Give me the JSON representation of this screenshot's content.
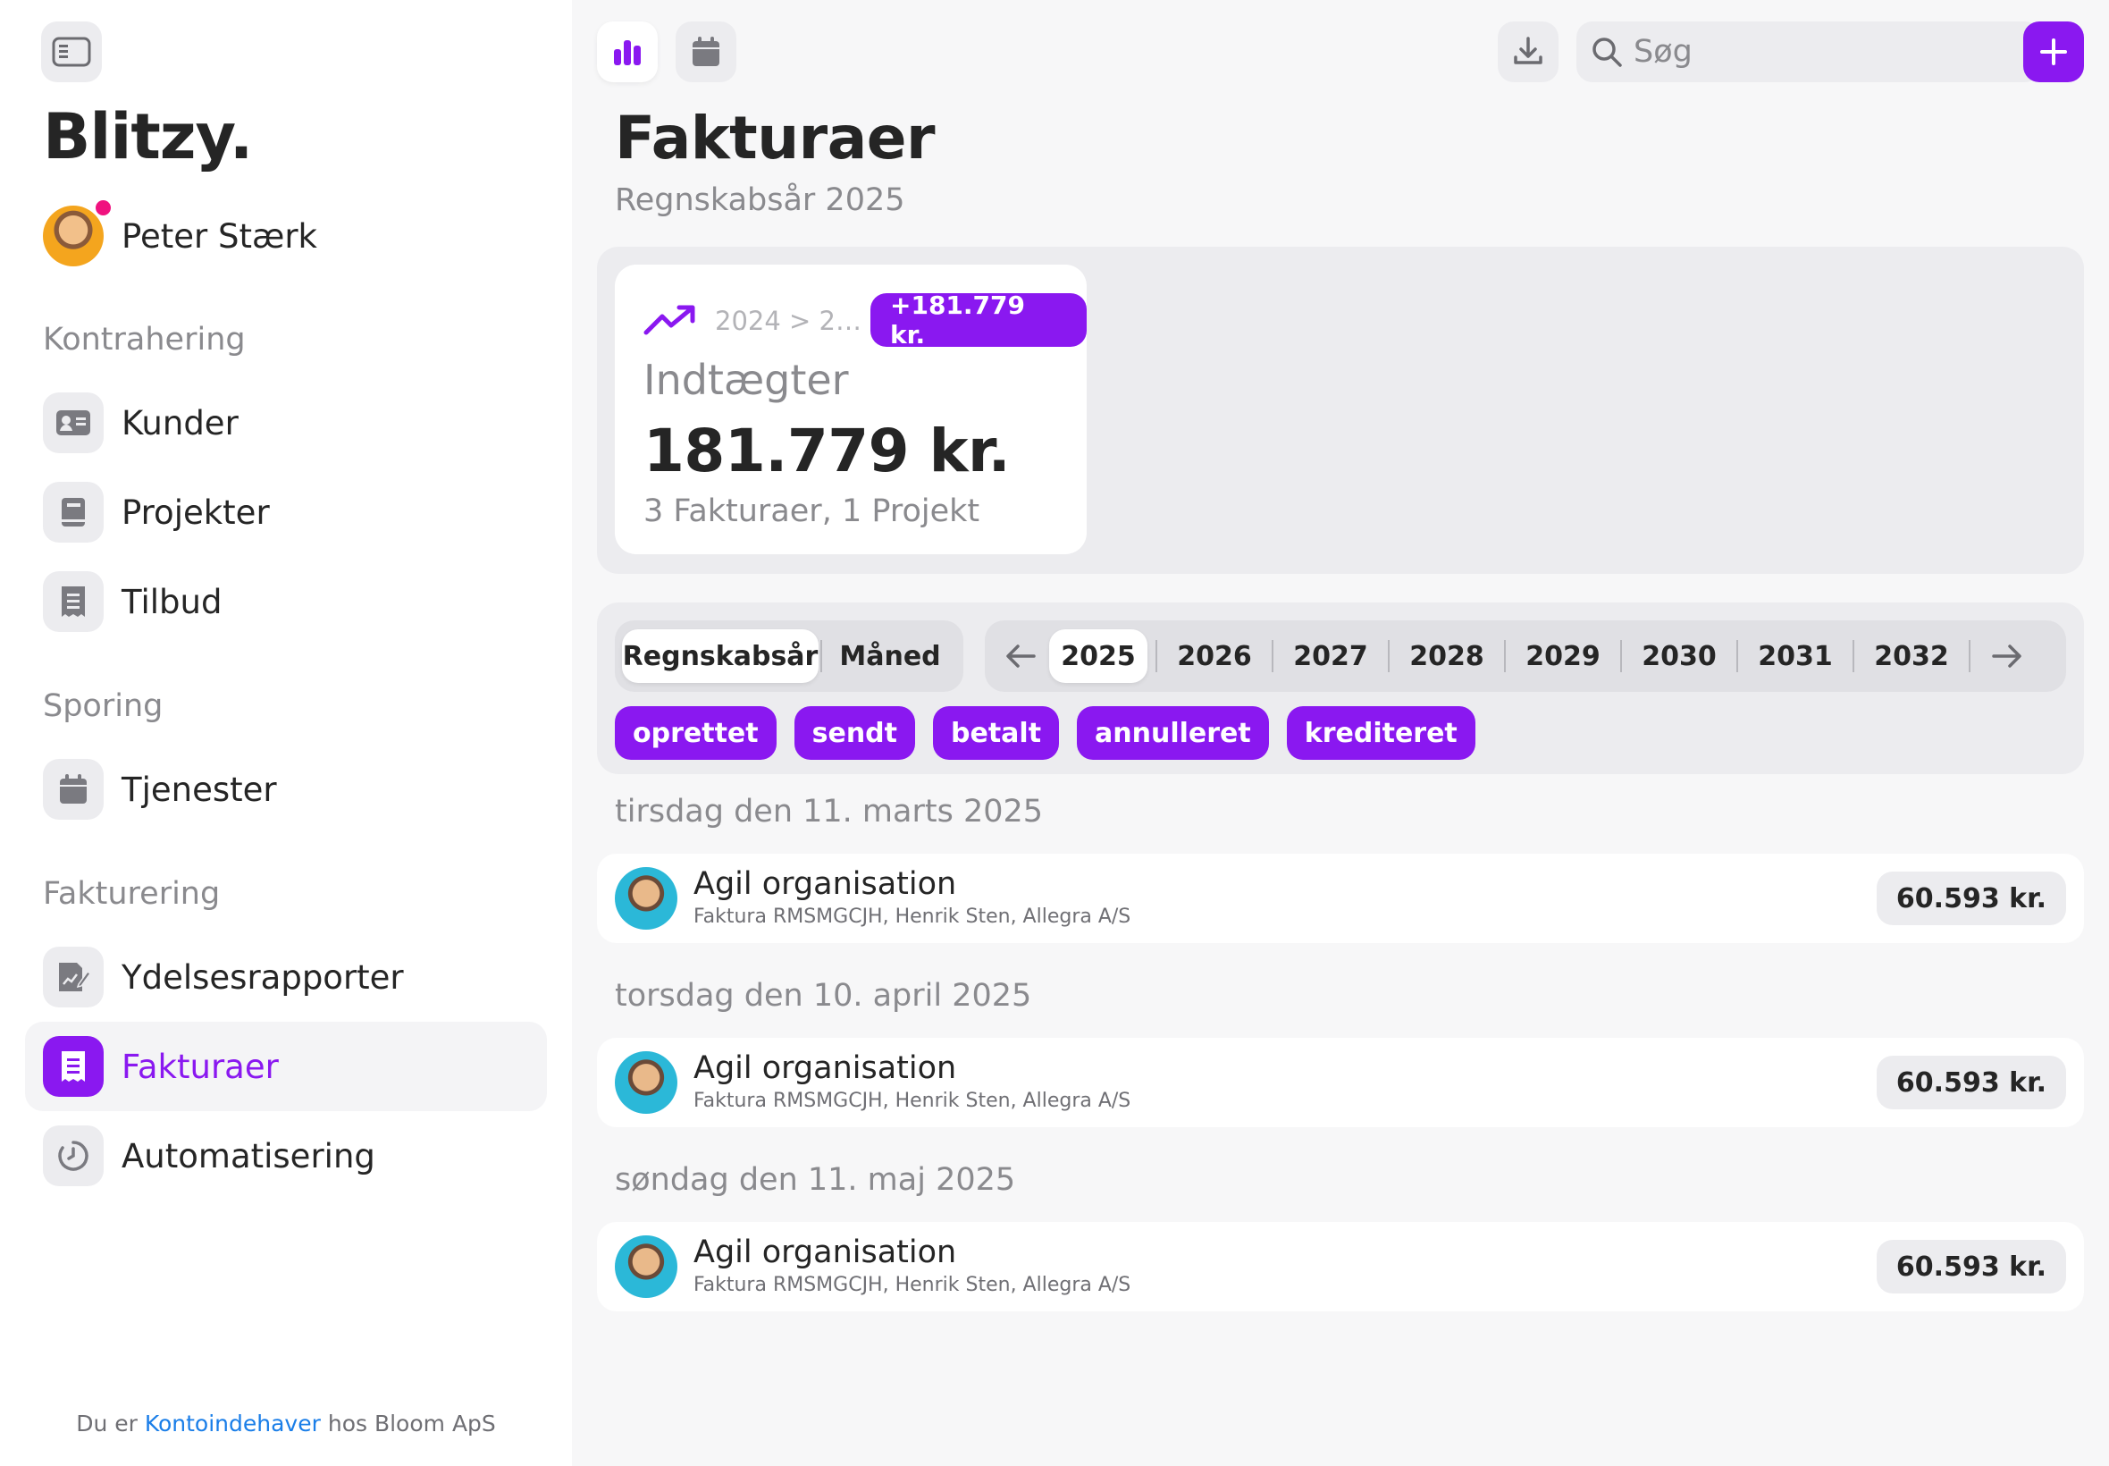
{
  "app": {
    "brand": "Blitzy."
  },
  "user": {
    "name": "Peter Stærk"
  },
  "sidebar": {
    "sections": [
      {
        "label": "Kontrahering"
      },
      {
        "label": "Sporing"
      },
      {
        "label": "Fakturering"
      }
    ],
    "items": [
      {
        "label": "Kunder",
        "icon": "contact-card-icon"
      },
      {
        "label": "Projekter",
        "icon": "book-icon"
      },
      {
        "label": "Tilbud",
        "icon": "receipt-icon"
      },
      {
        "label": "Tjenester",
        "icon": "calendar-icon"
      },
      {
        "label": "Ydelsesrapporter",
        "icon": "report-edit-icon"
      },
      {
        "label": "Fakturaer",
        "icon": "invoice-icon",
        "active": true
      },
      {
        "label": "Automatisering",
        "icon": "cycle-icon"
      }
    ],
    "footer": {
      "prefix": "Du er",
      "role": "Kontoindehaver",
      "suffix": "hos Bloom ApS"
    }
  },
  "toolbar": {
    "search_placeholder": "Søg"
  },
  "page": {
    "title": "Fakturaer",
    "subtitle": "Regnskabsår 2025"
  },
  "stat": {
    "period": "2024 > 2…",
    "delta": "+181.779 kr.",
    "label": "Indtægter",
    "value": "181.779 kr.",
    "meta": "3 Fakturaer, 1 Projekt"
  },
  "period_toggle": {
    "options": [
      "Regnskabsår",
      "Måned"
    ],
    "selected": "Regnskabsår"
  },
  "years": {
    "options": [
      "2025",
      "2026",
      "2027",
      "2028",
      "2029",
      "2030",
      "2031",
      "2032"
    ],
    "selected": "2025"
  },
  "status_filters": [
    "oprettet",
    "sendt",
    "betalt",
    "annulleret",
    "krediteret"
  ],
  "groups": [
    {
      "date": "tirsdag den 11. marts 2025",
      "invoices": [
        {
          "title": "Agil organisation",
          "subtitle": "Faktura RMSMGCJH, Henrik Sten, Allegra A/S",
          "amount": "60.593 kr."
        }
      ]
    },
    {
      "date": "torsdag den 10. april 2025",
      "invoices": [
        {
          "title": "Agil organisation",
          "subtitle": "Faktura RMSMGCJH, Henrik Sten, Allegra A/S",
          "amount": "60.593 kr."
        }
      ]
    },
    {
      "date": "søndag den 11. maj 2025",
      "invoices": [
        {
          "title": "Agil organisation",
          "subtitle": "Faktura RMSMGCJH, Henrik Sten, Allegra A/S",
          "amount": "60.593 kr."
        }
      ]
    }
  ],
  "colors": {
    "accent": "#8a18f0",
    "notification": "#f0127f",
    "link": "#1a7ee8"
  }
}
